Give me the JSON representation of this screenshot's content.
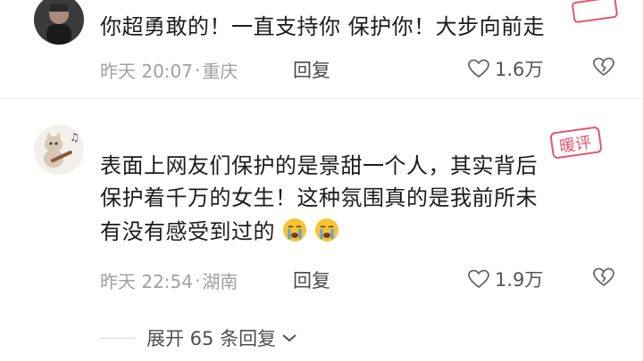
{
  "comments": [
    {
      "text": "你超勇敢的！一直支持你 保护你！大步向前走",
      "time": "昨天 20:07",
      "location": "重庆",
      "reply_label": "回复",
      "likes": "1.6万",
      "avatar_icon": "person-dark-photo"
    },
    {
      "text_line1": "表面上网友们保护的是景甜一个人，其实背后",
      "text_line2": "保护着千万的女生！这种氛围真的是我前所未",
      "text_line3": "有没有感受到过的",
      "time": "昨天 22:54",
      "location": "湖南",
      "reply_label": "回复",
      "likes": "1.9万",
      "avatar_icon": "cat-guitar-cartoon",
      "emoji": "crying-face-icon"
    }
  ],
  "expand_label": "展开 65 条回复",
  "watermark_text": "暖评",
  "colors": {
    "meta": "#a0a0a0",
    "text": "#1b1b1b",
    "watermark": "#e5566f",
    "emoji": "#f7c431"
  }
}
